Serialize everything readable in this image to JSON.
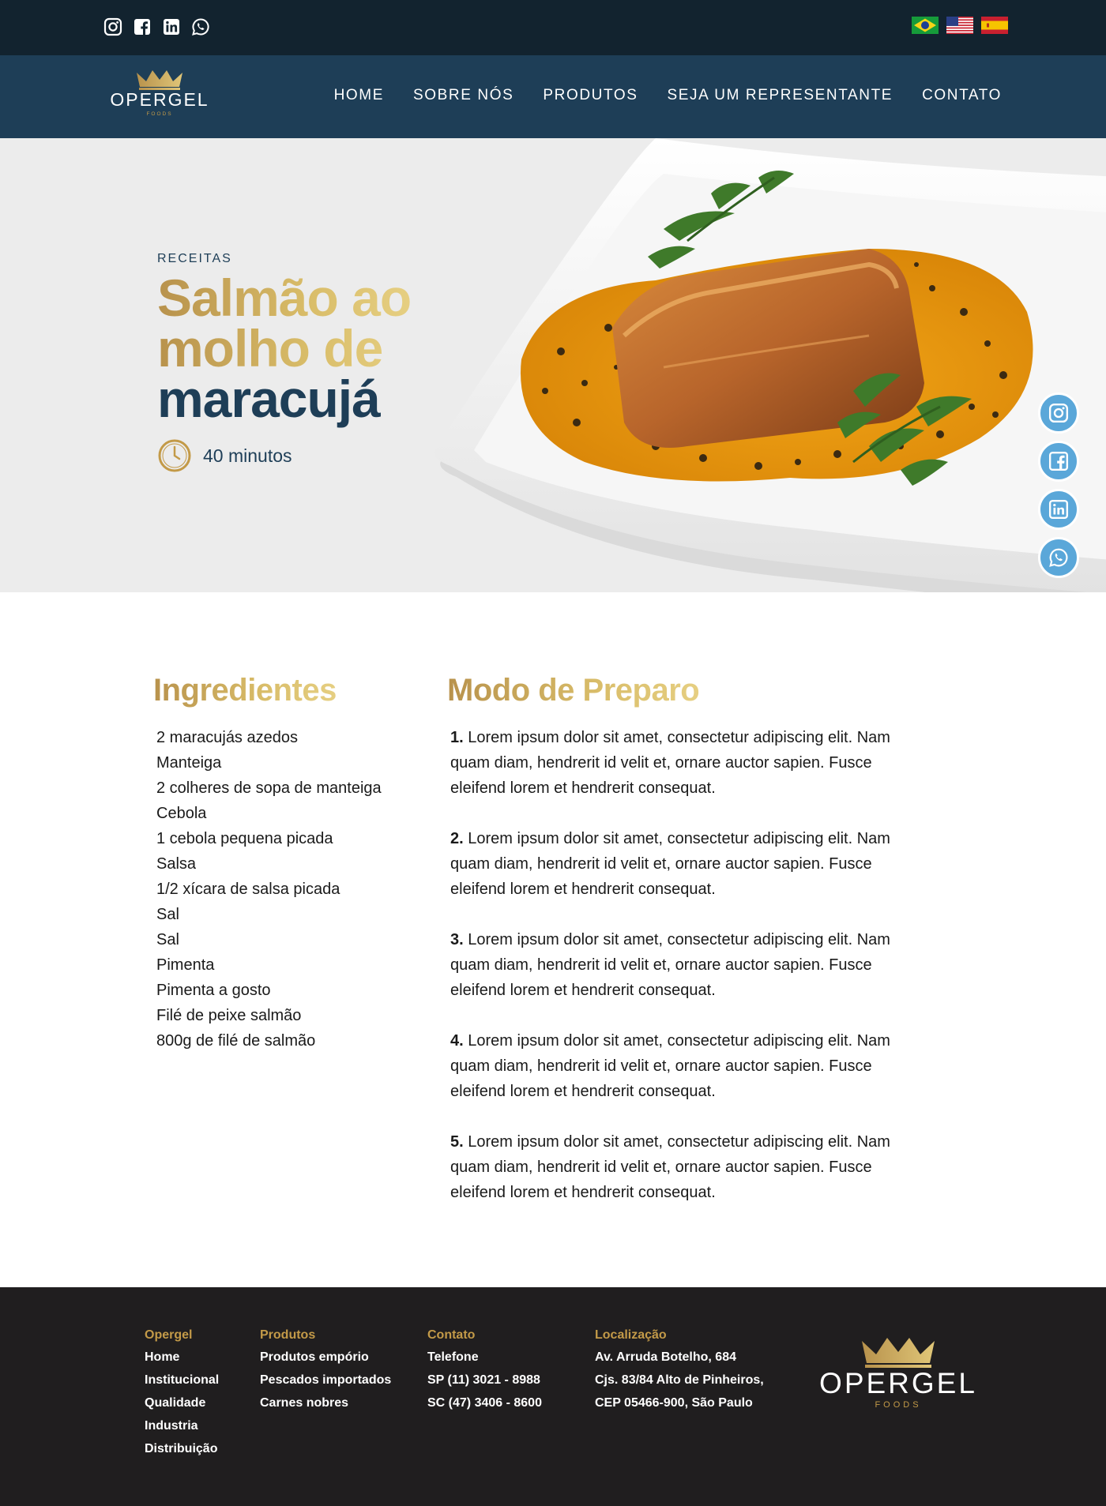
{
  "top_bar": {
    "social": [
      "instagram-icon",
      "facebook-icon",
      "linkedin-icon",
      "whatsapp-icon"
    ],
    "languages": [
      "brazil-flag",
      "usa-flag",
      "spain-flag"
    ]
  },
  "brand": {
    "name": "OPERGEL",
    "sub": "FOODS"
  },
  "nav": {
    "items": [
      "HOME",
      "SOBRE NÓS",
      "PRODUTOS",
      "SEJA UM REPRESENTANTE",
      "CONTATO"
    ]
  },
  "hero": {
    "eyebrow": "RECEITAS",
    "title_line1": "Salmão ao",
    "title_line2": "molho de",
    "title_line3": "maracujá",
    "time": "40 minutos"
  },
  "ingredients": {
    "heading": "Ingredientes",
    "items": [
      "2 maracujás azedos",
      "Manteiga",
      "2 colheres de sopa de manteiga",
      "Cebola",
      "1 cebola pequena picada",
      "Salsa",
      "1/2 xícara de salsa picada",
      "Sal",
      "Sal",
      "Pimenta",
      "Pimenta a gosto",
      "Filé de peixe salmão",
      "800g de filé de salmão"
    ]
  },
  "preparation": {
    "heading": "Modo de Preparo",
    "steps": [
      {
        "num": "1.",
        "text": "Lorem ipsum dolor sit amet, consectetur adipiscing elit. Nam quam diam, hendrerit id velit et, ornare auctor sapien. Fusce eleifend lorem et hendrerit consequat."
      },
      {
        "num": "2.",
        "text": "Lorem ipsum dolor sit amet, consectetur adipiscing elit. Nam quam diam, hendrerit id velit et, ornare auctor sapien. Fusce eleifend lorem et hendrerit consequat."
      },
      {
        "num": "3.",
        "text": "Lorem ipsum dolor sit amet, consectetur adipiscing elit. Nam quam diam, hendrerit id velit et, ornare auctor sapien. Fusce eleifend lorem et hendrerit consequat."
      },
      {
        "num": "4.",
        "text": "Lorem ipsum dolor sit amet, consectetur adipiscing elit. Nam quam diam, hendrerit id velit et, ornare auctor sapien. Fusce eleifend lorem et hendrerit consequat."
      },
      {
        "num": "5.",
        "text": "Lorem ipsum dolor sit amet, consectetur adipiscing elit. Nam quam diam, hendrerit id velit et, ornare auctor sapien. Fusce eleifend lorem et hendrerit consequat."
      }
    ]
  },
  "footer": {
    "opergel": {
      "heading": "Opergel",
      "links": [
        "Home",
        "Institucional",
        "Qualidade",
        "Industria",
        "Distribuição"
      ]
    },
    "produtos": {
      "heading": "Produtos",
      "links": [
        "Produtos empório",
        "Pescados importados",
        "Carnes nobres"
      ]
    },
    "contato": {
      "heading": "Contato",
      "lines": [
        "Telefone",
        "SP (11) 3021 - 8988",
        "SC (47) 3406 - 8600"
      ]
    },
    "localizacao": {
      "heading": "Localização",
      "lines": [
        "Av. Arruda Botelho, 684",
        "Cjs. 83/84 Alto de Pinheiros,",
        "CEP 05466-900, São Paulo"
      ]
    }
  },
  "colors": {
    "navy": "#1e3e57",
    "dark": "#12232f",
    "gold": "#c39a48",
    "footer_bg": "#201e1f",
    "accent_blue": "#5aa7d9"
  }
}
